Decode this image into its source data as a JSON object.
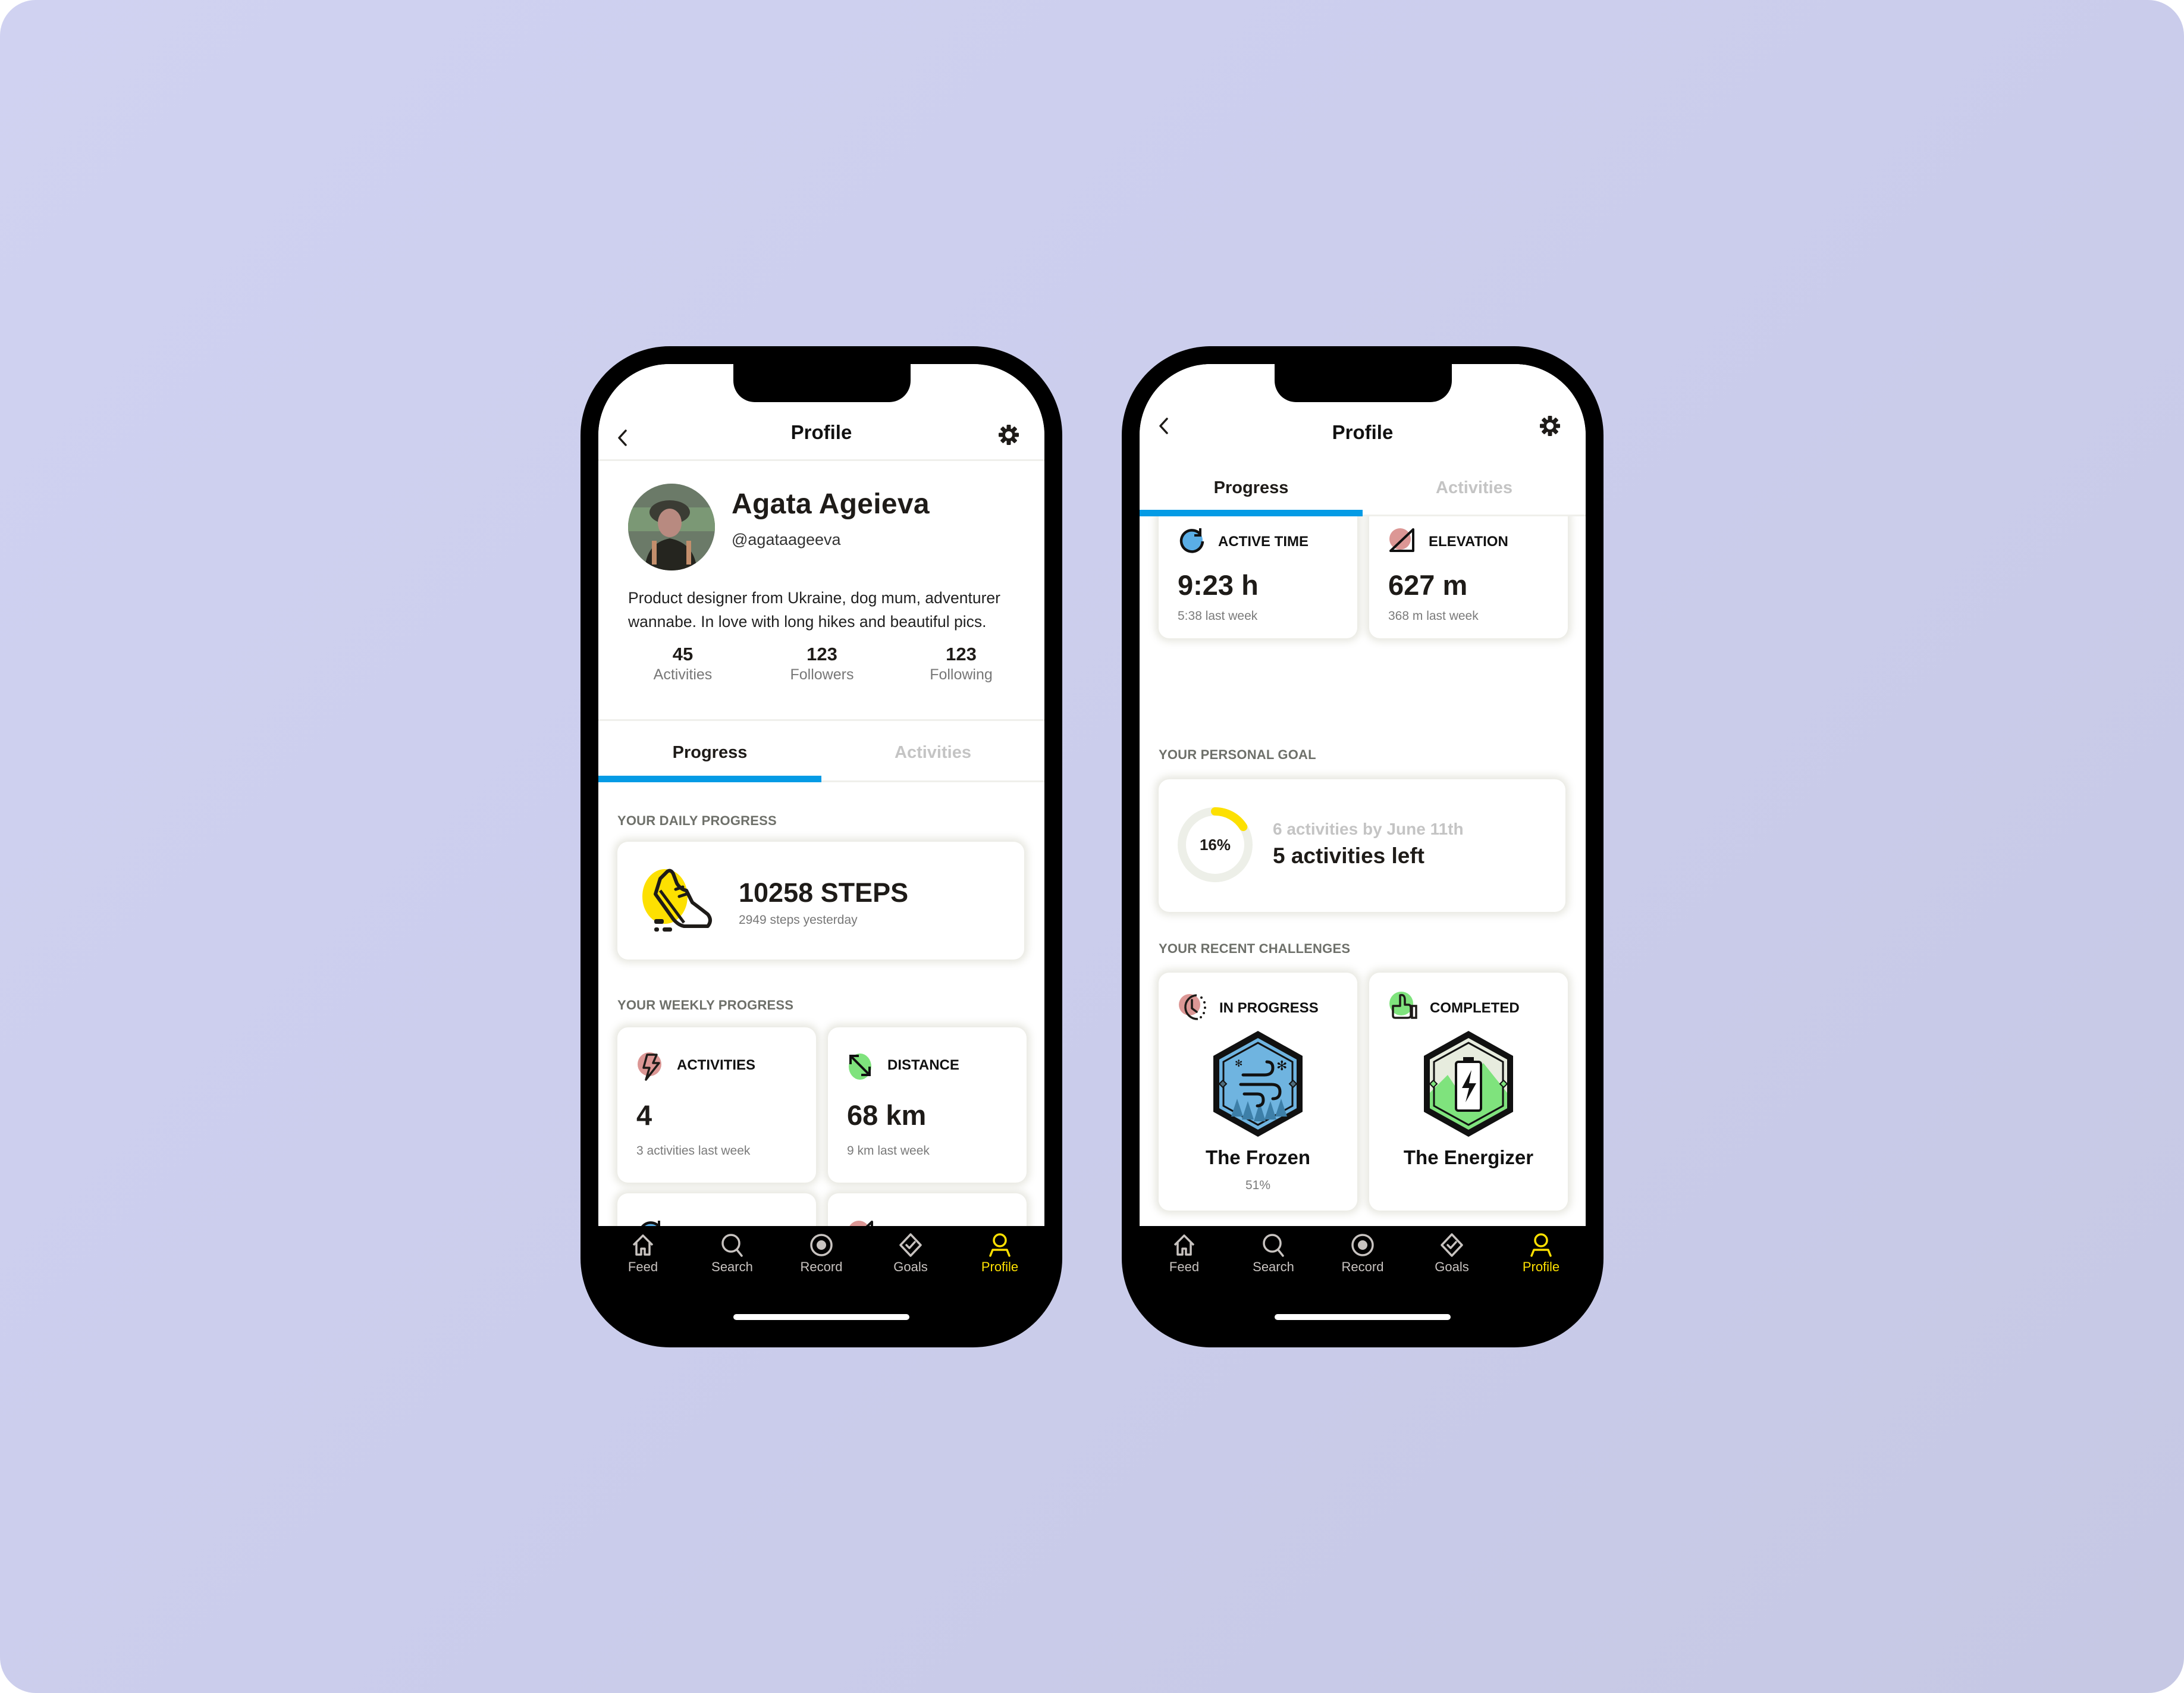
{
  "colors": {
    "accent_blue": "#049be5",
    "accent_yellow": "#fde001",
    "nav_inactive": "#c8c3c0",
    "text_dark": "#1e1b18"
  },
  "left_phone": {
    "header": {
      "title": "Profile",
      "back_icon": "chevron-left-icon",
      "settings_icon": "gear-icon"
    },
    "profile": {
      "name": "Agata Ageieva",
      "handle": "@agataageeva",
      "bio": "Product designer from Ukraine, dog mum, adventurer wannabe. In love with long hikes and beautiful pics.",
      "stats": [
        {
          "value": "45",
          "label": "Activities"
        },
        {
          "value": "123",
          "label": "Followers"
        },
        {
          "value": "123",
          "label": "Following"
        }
      ]
    },
    "tabs": [
      {
        "label": "Progress",
        "active": true
      },
      {
        "label": "Activities",
        "active": false
      }
    ],
    "daily": {
      "section_title": "YOUR DAILY PROGRESS",
      "steps_value": "10258 STEPS",
      "steps_sub": "2949 steps yesterday",
      "icon": "sneaker-icon"
    },
    "weekly": {
      "section_title": "YOUR WEEKLY PROGRESS",
      "cards": [
        {
          "title": "ACTIVITIES",
          "value": "4",
          "sub": "3 activities last week",
          "icon": "lightning-icon"
        },
        {
          "title": "DISTANCE",
          "value": "68 km",
          "sub": "9 km last week",
          "icon": "diagonal-arrows-icon"
        }
      ]
    }
  },
  "right_phone": {
    "header": {
      "title": "Profile",
      "back_icon": "chevron-left-icon",
      "settings_icon": "gear-icon"
    },
    "tabs": [
      {
        "label": "Progress",
        "active": true
      },
      {
        "label": "Activities",
        "active": false
      }
    ],
    "weekly_partial": [
      {
        "sub": "3 activities last week"
      },
      {
        "sub": "9 km last week"
      }
    ],
    "weekly_cards": [
      {
        "title": "ACTIVE TIME",
        "value": "9:23 h",
        "sub": "5:38 last week",
        "icon": "refresh-clock-icon"
      },
      {
        "title": "ELEVATION",
        "value": "627 m",
        "sub": "368 m last week",
        "icon": "elevation-triangle-icon"
      }
    ],
    "goal": {
      "section_title": "YOUR PERSONAL GOAL",
      "percent_label": "16%",
      "progress_fraction": 0.16,
      "target": "6 activities by June 11th",
      "remaining": "5 activities left"
    },
    "challenges": {
      "section_title": "YOUR RECENT CHALLENGES",
      "items": [
        {
          "status": "IN PROGRESS",
          "name": "The Frozen",
          "percent": "51%",
          "status_icon": "clock-icon",
          "badge": "frozen-wind-badge-icon"
        },
        {
          "status": "COMPLETED",
          "name": "The Energizer",
          "percent": "",
          "status_icon": "thumbs-up-icon",
          "badge": "battery-badge-icon"
        }
      ]
    }
  },
  "nav": {
    "items": [
      {
        "label": "Feed",
        "icon": "home-icon",
        "active": false
      },
      {
        "label": "Search",
        "icon": "search-icon",
        "active": false
      },
      {
        "label": "Record",
        "icon": "record-icon",
        "active": false
      },
      {
        "label": "Goals",
        "icon": "goals-diamond-check-icon",
        "active": false
      },
      {
        "label": "Profile",
        "icon": "user-icon",
        "active": true
      }
    ]
  }
}
